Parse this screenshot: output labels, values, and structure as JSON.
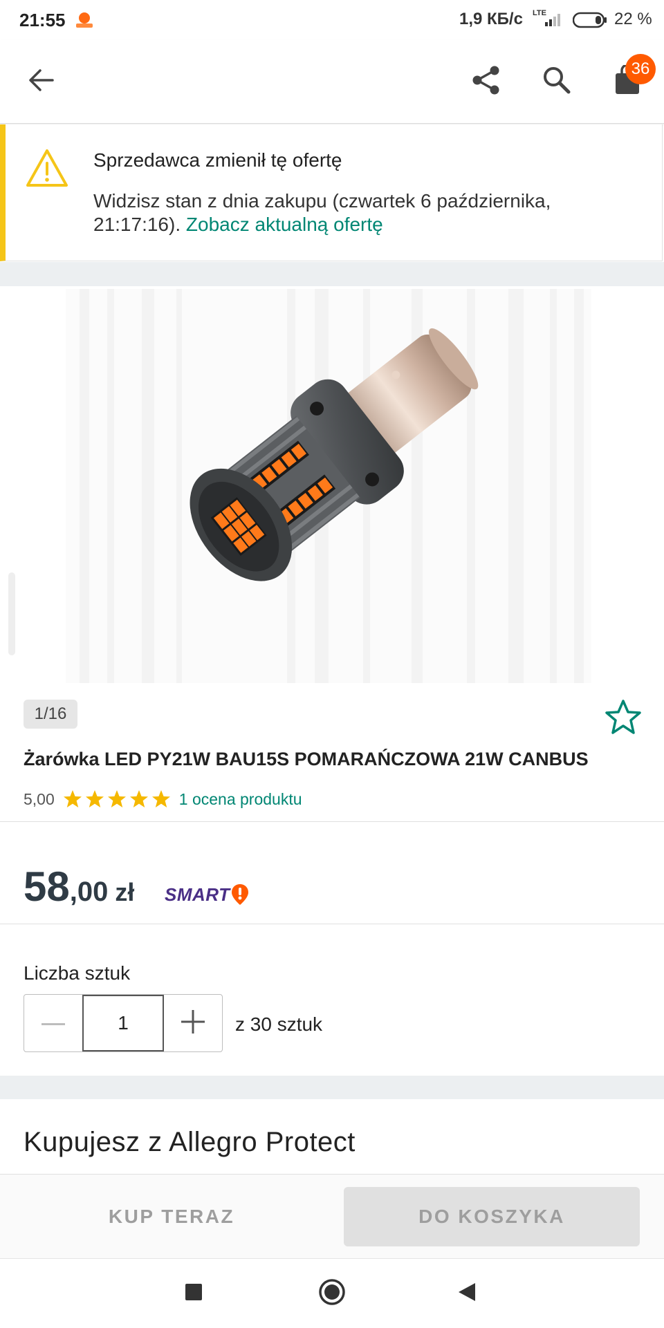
{
  "status_bar": {
    "time": "21:55",
    "network_speed": "1,9 КБ/с",
    "network_type": "LTE",
    "battery": "22 %"
  },
  "header": {
    "back_icon": "arrow-left-icon",
    "share_icon": "share-icon",
    "search_icon": "search-icon",
    "cart_icon": "shopping-bag-icon",
    "cart_count": "36"
  },
  "notice": {
    "icon": "warning-icon",
    "title": "Sprzedawca zmienił tę ofertę",
    "body": "Widzisz stan z dnia zakupu (czwartek 6 października, 21:17:16).",
    "link": "Zobacz aktualną ofertę"
  },
  "gallery": {
    "counter": "1/16",
    "favorite_icon": "star-outline-icon"
  },
  "product": {
    "title": "Żarówka LED PY21W BAU15S POMARAŃCZOWA 21W CANBUS",
    "rating_value": "5,00",
    "rating_stars": 5,
    "rating_link": "1 ocena produktu"
  },
  "price": {
    "integer": "58",
    "decimal": ",00",
    "currency": "zł",
    "badge": "SMART"
  },
  "quantity": {
    "label": "Liczba sztuk",
    "value": "1",
    "stock": "z 30 sztuk",
    "minus_icon": "minus-icon",
    "plus_icon": "plus-icon"
  },
  "protect": {
    "title": "Kupujesz z Allegro Protect"
  },
  "actions": {
    "buy_now": "KUP TERAZ",
    "add_to_cart": "DO KOSZYKA"
  },
  "colors": {
    "accent_teal": "#008673",
    "badge_orange": "#ff5a00",
    "notice_yellow": "#f5c518",
    "star_yellow": "#f5b800",
    "smart_purple": "#4a2f86"
  }
}
